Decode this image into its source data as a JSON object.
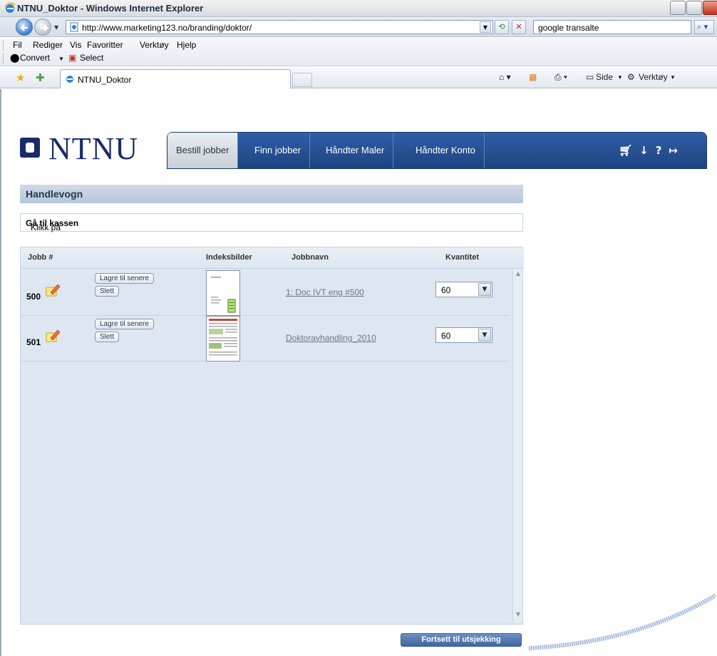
{
  "window": {
    "title": "NTNU_Doktor - Windows Internet Explorer"
  },
  "addressbar": {
    "url": "http://www.marketing123.no/branding/doktor/",
    "search_value": "google transalte"
  },
  "menubar": {
    "items": [
      "Fil",
      "Rediger",
      "Vis",
      "Favoritter",
      "Verktøy",
      "Hjelp"
    ],
    "convert_label": "Convert",
    "select_label": "Select"
  },
  "tabs": {
    "active_label": "NTNU_Doktor"
  },
  "commandbar": {
    "side_label": "Side",
    "tools_label": "Verktøy"
  },
  "site": {
    "logo_text": "NTNU",
    "nav": [
      "Bestill jobber",
      "Finn jobber",
      "Håndter Maler",
      "Håndter Konto"
    ],
    "nav_icons": "    "
  },
  "cart": {
    "heading": "Handlevogn",
    "instruction_prefix": "Klikk på ",
    "instruction_bold": "Gå til kassen",
    "instruction_suffix": ".",
    "columns": {
      "job": "Jobb #",
      "thumbs": "Indeksbilder",
      "name": "Jobbnavn",
      "qty": "Kvantitet"
    },
    "rows": [
      {
        "job": "500",
        "save_label": "Lagre til senere",
        "delete_label": "Slett",
        "name": "1: Doc IVT eng #500",
        "qty": "60"
      },
      {
        "job": "501",
        "save_label": "Lagre til senere",
        "delete_label": "Slett",
        "name": "Doktoravhandling_2010",
        "qty": "60"
      }
    ],
    "proceed_label": "Fortsett til utsjekking"
  }
}
